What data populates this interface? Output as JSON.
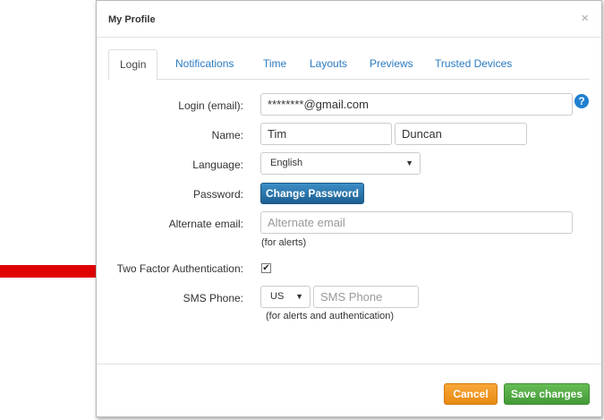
{
  "dialog": {
    "title": "My Profile",
    "close": "×"
  },
  "tabs": [
    {
      "label": "Login",
      "active": true
    },
    {
      "label": "Notifications",
      "active": false
    },
    {
      "label": "Time",
      "active": false
    },
    {
      "label": "Layouts",
      "active": false
    },
    {
      "label": "Previews",
      "active": false
    },
    {
      "label": "Trusted Devices",
      "active": false
    }
  ],
  "form": {
    "login_label": "Login (email):",
    "login_value": "********@gmail.com",
    "name_label": "Name:",
    "first_name": "Tim",
    "last_name": "Duncan",
    "language_label": "Language:",
    "language_value": "English",
    "password_label": "Password:",
    "change_password": "Change Password",
    "alt_email_label": "Alternate email:",
    "alt_email_placeholder": "Alternate email",
    "alt_email_hint": "(for alerts)",
    "two_factor_label": "Two Factor Authentication:",
    "two_factor_checked": true,
    "sms_label": "SMS Phone:",
    "country_value": "US",
    "sms_placeholder": "SMS Phone",
    "sms_hint": "(for alerts and authentication)"
  },
  "footer": {
    "cancel": "Cancel",
    "save": "Save changes"
  },
  "icons": {
    "help": "?",
    "caret": "▼",
    "check": "✔"
  },
  "colors": {
    "link_blue": "#2a7ac0",
    "primary": "#1d5f91",
    "cancel_orange": "#e88a12",
    "save_green": "#449a37",
    "arrow_red": "#e00000"
  }
}
